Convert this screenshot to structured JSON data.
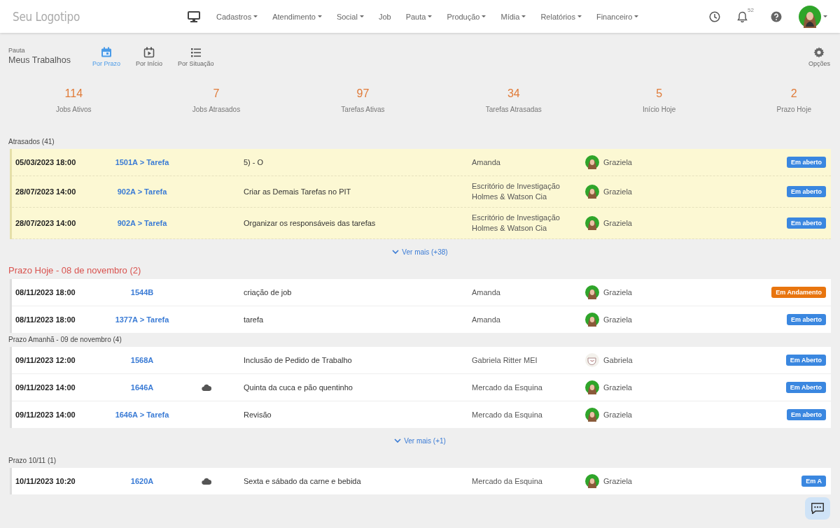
{
  "logo": "Seu Logotipo",
  "nav": [
    {
      "label": "Cadastros",
      "has_menu": true
    },
    {
      "label": "Atendimento",
      "has_menu": true
    },
    {
      "label": "Social",
      "has_menu": true
    },
    {
      "label": "Job",
      "has_menu": false
    },
    {
      "label": "Pauta",
      "has_menu": true
    },
    {
      "label": "Produção",
      "has_menu": true
    },
    {
      "label": "Mídia",
      "has_menu": true
    },
    {
      "label": "Relatórios",
      "has_menu": true
    },
    {
      "label": "Financeiro",
      "has_menu": true
    }
  ],
  "notifications": {
    "count": "52"
  },
  "page": {
    "breadcrumb": "Pauta",
    "title": "Meus Trabalhos"
  },
  "views": [
    {
      "label": "Por Prazo",
      "kind": "calendar",
      "selected": true
    },
    {
      "label": "Por Início",
      "kind": "play",
      "selected": false
    },
    {
      "label": "Por Situação",
      "kind": "list",
      "selected": false
    }
  ],
  "options": {
    "label": "Opções"
  },
  "stats": [
    {
      "value": "114",
      "label": "Jobs Ativos"
    },
    {
      "value": "7",
      "label": "Jobs Atrasados"
    },
    {
      "value": "97",
      "label": "Tarefas Ativas"
    },
    {
      "value": "34",
      "label": "Tarefas Atrasadas"
    },
    {
      "value": "5",
      "label": "Início Hoje"
    },
    {
      "value": "2",
      "label": "Prazo Hoje"
    }
  ],
  "sections": [
    {
      "title": "Atrasados (41)",
      "kind": "normal",
      "highlight": true,
      "more": "Ver mais (+38)",
      "rows": [
        {
          "date": "05/03/2023 18:00",
          "job": "1501A > Tarefa",
          "cloud": false,
          "task": "5) - O",
          "client": [
            "Amanda"
          ],
          "avatar": {
            "kind": "person"
          },
          "user": "Graziela",
          "status": {
            "label": "Em aberto",
            "kind": "open"
          }
        },
        {
          "date": "28/07/2023 14:00",
          "job": "902A > Tarefa",
          "cloud": false,
          "task": "Criar as Demais Tarefas no PIT",
          "client": [
            "Escritório de Investigação",
            "Holmes & Watson Cia"
          ],
          "avatar": {
            "kind": "person"
          },
          "user": "Graziela",
          "status": {
            "label": "Em aberto",
            "kind": "open"
          }
        },
        {
          "date": "28/07/2023 14:00",
          "job": "902A > Tarefa",
          "cloud": false,
          "task": "Organizar os responsáveis das tarefas",
          "client": [
            "Escritório de Investigação",
            "Holmes & Watson Cia"
          ],
          "avatar": {
            "kind": "person"
          },
          "user": "Graziela",
          "status": {
            "label": "Em aberto",
            "kind": "open"
          }
        }
      ]
    },
    {
      "title": "Prazo Hoje - 08 de novembro (2)",
      "kind": "alert",
      "highlight": false,
      "rows": [
        {
          "date": "08/11/2023 18:00",
          "job": "1544B",
          "cloud": false,
          "task": "criação de job",
          "client": [
            "Amanda"
          ],
          "avatar": {
            "kind": "person"
          },
          "user": "Graziela",
          "status": {
            "label": "Em Andamento",
            "kind": "progress"
          }
        },
        {
          "date": "08/11/2023 18:00",
          "job": "1377A > Tarefa",
          "cloud": false,
          "task": "tarefa",
          "client": [
            "Amanda"
          ],
          "avatar": {
            "kind": "person"
          },
          "user": "Graziela",
          "status": {
            "label": "Em aberto",
            "kind": "open"
          }
        }
      ]
    },
    {
      "title": "Prazo Amanhã - 09 de novembro (4)",
      "kind": "normal",
      "highlight": false,
      "more": "Ver mais (+1)",
      "rows": [
        {
          "date": "09/11/2023 12:00",
          "job": "1568A",
          "cloud": false,
          "task": "Inclusão de Pedido de Trabalho",
          "client": [
            "Gabriela Ritter MEI"
          ],
          "avatar": {
            "kind": "cup"
          },
          "user": "Gabriela",
          "status": {
            "label": "Em Aberto",
            "kind": "open"
          }
        },
        {
          "date": "09/11/2023 14:00",
          "job": "1646A",
          "cloud": true,
          "task": "Quinta da cuca e pão quentinho",
          "client": [
            "Mercado da Esquina"
          ],
          "avatar": {
            "kind": "person"
          },
          "user": "Graziela",
          "status": {
            "label": "Em Aberto",
            "kind": "open"
          }
        },
        {
          "date": "09/11/2023 14:00",
          "job": "1646A > Tarefa",
          "cloud": false,
          "task": "Revisão",
          "client": [
            "Mercado da Esquina"
          ],
          "avatar": {
            "kind": "person"
          },
          "user": "Graziela",
          "status": {
            "label": "Em aberto",
            "kind": "open"
          }
        }
      ]
    },
    {
      "title": "Prazo 10/11 (1)",
      "kind": "normal",
      "highlight": false,
      "rows": [
        {
          "date": "10/11/2023 10:20",
          "job": "1620A",
          "cloud": true,
          "task": "Sexta e sábado da carne e bebida",
          "client": [
            "Mercado da Esquina"
          ],
          "avatar": {
            "kind": "person"
          },
          "user": "Graziela",
          "status": {
            "label": "Em A",
            "kind": "open"
          }
        }
      ]
    }
  ]
}
